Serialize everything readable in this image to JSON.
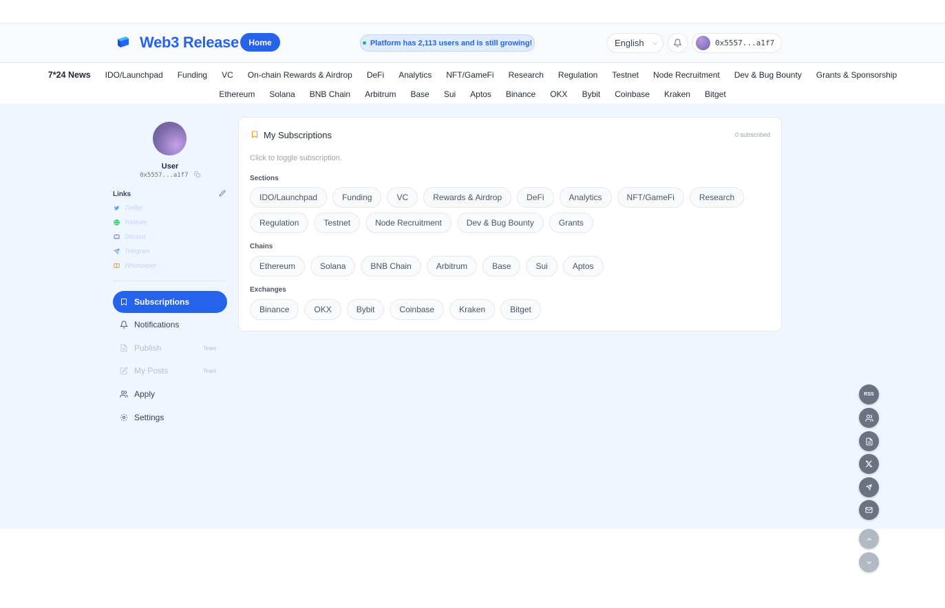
{
  "header": {
    "brand": "Web3 Release",
    "home_label": "Home",
    "growth_text": "Platform has 2,113 users and is still growing!",
    "language": "English",
    "wallet_address": "0x5557...a1f7"
  },
  "nav": {
    "row1": [
      "7*24 News",
      "IDO/Launchpad",
      "Funding",
      "VC",
      "On-chain Rewards & Airdrop",
      "DeFi",
      "Analytics",
      "NFT/GameFi",
      "Research",
      "Regulation",
      "Testnet",
      "Node Recruitment",
      "Dev & Bug Bounty",
      "Grants & Sponsorship"
    ],
    "row2": [
      "Ethereum",
      "Solana",
      "BNB Chain",
      "Arbitrum",
      "Base",
      "Sui",
      "Aptos",
      "Binance",
      "OKX",
      "Bybit",
      "Coinbase",
      "Kraken",
      "Bitget"
    ]
  },
  "sidebar": {
    "user_name": "User",
    "user_address": "0x5557...a1f7",
    "links_title": "Links",
    "links": [
      {
        "label": "Twitter",
        "icon": "twitter-icon",
        "color": "#60a5fa"
      },
      {
        "label": "Website",
        "icon": "globe-icon",
        "color": "#22c55e"
      },
      {
        "label": "Discord",
        "icon": "discord-icon",
        "color": "#6366f1"
      },
      {
        "label": "Telegram",
        "icon": "telegram-icon",
        "color": "#60a5fa"
      },
      {
        "label": "Whitepaper",
        "icon": "book-icon",
        "color": "#f59e0b"
      }
    ],
    "menu": [
      {
        "label": "Subscriptions",
        "icon": "bookmark-icon",
        "state": "active",
        "tag": ""
      },
      {
        "label": "Notifications",
        "icon": "bell-icon",
        "state": "normal",
        "tag": ""
      },
      {
        "label": "Publish",
        "icon": "document-icon",
        "state": "disabled",
        "tag": "Team"
      },
      {
        "label": "My Posts",
        "icon": "edit-icon",
        "state": "disabled",
        "tag": "Team"
      },
      {
        "label": "Apply",
        "icon": "users-icon",
        "state": "normal",
        "tag": ""
      },
      {
        "label": "Settings",
        "icon": "gear-icon",
        "state": "normal",
        "tag": ""
      }
    ]
  },
  "subscriptions": {
    "title": "My Subscriptions",
    "count_text": "0 subscribed",
    "hint": "Click to toggle subscription.",
    "groups": [
      {
        "label": "Sections",
        "rows": [
          [
            "IDO/Launchpad",
            "Funding",
            "VC",
            "Rewards & Airdrop",
            "DeFi",
            "Analytics",
            "NFT/GameFi",
            "Research"
          ],
          [
            "Regulation",
            "Testnet",
            "Node Recruitment",
            "Dev & Bug Bounty",
            "Grants"
          ]
        ]
      },
      {
        "label": "Chains",
        "rows": [
          [
            "Ethereum",
            "Solana",
            "BNB Chain",
            "Arbitrum",
            "Base",
            "Sui",
            "Aptos"
          ]
        ]
      },
      {
        "label": "Exchanges",
        "rows": [
          [
            "Binance",
            "OKX",
            "Bybit",
            "Coinbase",
            "Kraken",
            "Bitget"
          ]
        ]
      }
    ]
  },
  "floating": {
    "rss_label": "RSS",
    "buttons": [
      "rss-icon",
      "users-icon",
      "document-icon",
      "x-icon",
      "telegram-icon",
      "mail-icon",
      "arrow-up-icon",
      "arrow-down-icon"
    ]
  },
  "colors": {
    "accent": "#2563eb",
    "background": "#eff6ff",
    "growth_dot": "#10b981"
  }
}
